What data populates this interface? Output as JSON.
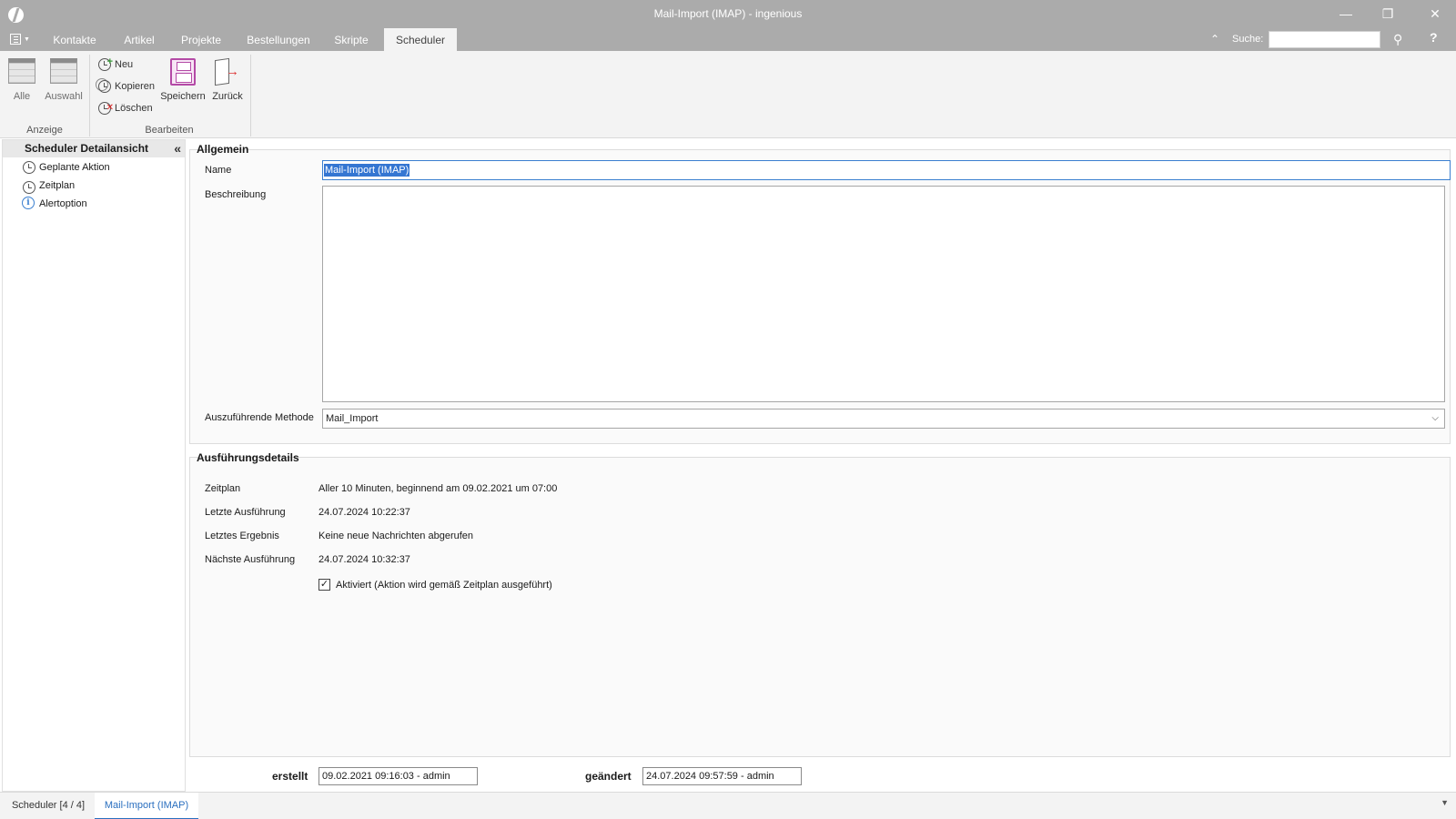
{
  "window": {
    "title": "Mail-Import (IMAP) - ingenious",
    "minimize": "—",
    "restore": "❐",
    "close": "✕"
  },
  "tabs": [
    "Kontakte",
    "Artikel",
    "Projekte",
    "Bestellungen",
    "Skripte",
    "Scheduler"
  ],
  "active_tab": "Scheduler",
  "search": {
    "label": "Suche:",
    "value": ""
  },
  "help": "?",
  "ribbon": {
    "anzeige": {
      "label": "Anzeige",
      "alle": "Alle",
      "auswahl": "Auswahl"
    },
    "bearbeiten": {
      "label": "Bearbeiten",
      "neu": "Neu",
      "kopieren": "Kopieren",
      "loeschen": "Löschen",
      "speichern": "Speichern",
      "zurueck": "Zurück"
    }
  },
  "nav": {
    "header": "Scheduler Detailansicht",
    "items": [
      "Geplante Aktion",
      "Zeitplan",
      "Alertoption"
    ]
  },
  "allgemein": {
    "title": "Allgemein",
    "name_label": "Name",
    "name_value": "Mail-Import (IMAP)",
    "beschreibung_label": "Beschreibung",
    "beschreibung_value": "",
    "methode_label": "Auszuführende Methode",
    "methode_value": "Mail_Import"
  },
  "details": {
    "title": "Ausführungsdetails",
    "zeitplan_label": "Zeitplan",
    "zeitplan_value": "Aller 10 Minuten, beginnend am 09.02.2021 um 07:00",
    "letzte_label": "Letzte Ausführung",
    "letzte_value": "24.07.2024 10:22:37",
    "ergebnis_label": "Letztes Ergebnis",
    "ergebnis_value": "Keine neue Nachrichten abgerufen",
    "naechste_label": "Nächste Ausführung",
    "naechste_value": "24.07.2024 10:32:37",
    "aktiviert_label": "Aktiviert (Aktion wird gemäß Zeitplan ausgeführt)",
    "aktiviert_checked": true
  },
  "footer": {
    "erstellt_label": "erstellt",
    "erstellt_value": "09.02.2021 09:16:03 - admin",
    "geaendert_label": "geändert",
    "geaendert_value": "24.07.2024 09:57:59 - admin"
  },
  "bottom_tabs": [
    "Scheduler [4 / 4]",
    "Mail-Import (IMAP)"
  ],
  "bottom_active": "Mail-Import (IMAP)",
  "colors": {
    "titlebar": "#ababab",
    "accent": "#2a6fbf",
    "selection": "#3476d2"
  }
}
